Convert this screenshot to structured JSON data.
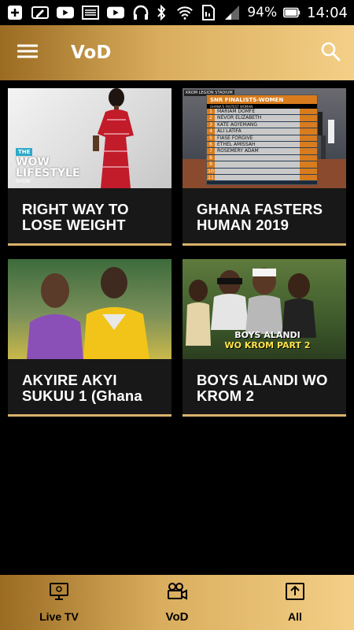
{
  "status_bar": {
    "battery": "94%",
    "time": "14:04",
    "icons_left": [
      "add-icon",
      "edit-icon",
      "youtube-icon",
      "image-icon",
      "youtube-icon",
      "headset-icon"
    ],
    "icons_right": [
      "bluetooth-icon",
      "wifi-icon",
      "sim-icon",
      "signal-icon",
      "battery-icon"
    ]
  },
  "app_bar": {
    "title": "VoD",
    "menu_icon": "hamburger-menu-icon",
    "search_icon": "search-icon"
  },
  "videos": [
    {
      "title": "RIGHT WAY TO LOSE WEIGHT",
      "thumb": {
        "tag": "THE",
        "line1": "WOW",
        "line2": "LIFESTYLE",
        "line3": "SHOW"
      }
    },
    {
      "title": "GHANA FASTERS HUMAN 2019",
      "thumb": {
        "stadium": "KROM LEGION STADIUM",
        "header": "SNR FINALISTS-WOMEN",
        "sub": "GHANA'S FASTEST WOMAN",
        "rows": [
          "MARIAM DOMFE",
          "NEVOR ELIZABETH",
          "KATE AGYEMANG",
          "ALI LATIFA",
          "FIASE FORGIVE",
          "ETHEL AMISSAH",
          "ROSEMERY ADAM",
          "",
          "",
          "",
          ""
        ]
      }
    },
    {
      "title": "AKYIRE AKYI SUKUU 1 (Ghana",
      "thumb": {}
    },
    {
      "title": "BOYS ALANDI WO KROM 2",
      "thumb": {
        "line1": "BOYS ALANDI",
        "line2": "WO KROM PART 2"
      }
    }
  ],
  "bottom_nav": [
    {
      "label": "Live TV",
      "icon": "tv-icon"
    },
    {
      "label": "VoD",
      "icon": "video-camera-icon"
    },
    {
      "label": "All",
      "icon": "upload-box-icon"
    }
  ]
}
